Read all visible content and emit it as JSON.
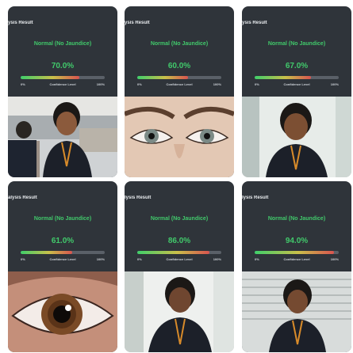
{
  "cards": [
    {
      "header": "ysis Result",
      "status": "Normal (No Jaundice)",
      "confidence_text": "70.0%",
      "confidence": 0.7,
      "scale": {
        "min": "0%",
        "label": "Confidence Level",
        "max": "100%"
      },
      "image": "classroom-portrait"
    },
    {
      "header": "ysis Result",
      "status": "Normal (No Jaundice)",
      "confidence_text": "60.0%",
      "confidence": 0.6,
      "scale": {
        "min": "0%",
        "label": "Confidence Level",
        "max": "100%"
      },
      "image": "two-eyes-closeup"
    },
    {
      "header": "ysis Result",
      "status": "Normal (No Jaundice)",
      "confidence_text": "67.0%",
      "confidence": 0.67,
      "scale": {
        "min": "0%",
        "label": "Confidence Level",
        "max": "100%"
      },
      "image": "portrait-window"
    },
    {
      "header": "alysis Result",
      "status": "Normal (No Jaundice)",
      "confidence_text": "61.0%",
      "confidence": 0.61,
      "scale": {
        "min": "0%",
        "label": "Confidence Level",
        "max": "100%"
      },
      "image": "eye-closeup"
    },
    {
      "header": "lysis Result",
      "status": "Normal (No Jaundice)",
      "confidence_text": "86.0%",
      "confidence": 0.86,
      "scale": {
        "min": "0%",
        "label": "Confidence Level",
        "max": "100%"
      },
      "image": "portrait-window"
    },
    {
      "header": "lysis Result",
      "status": "Normal (No Jaundice)",
      "confidence_text": "94.0%",
      "confidence": 0.94,
      "scale": {
        "min": "0%",
        "label": "Confidence Level",
        "max": "100%"
      },
      "image": "portrait-blinds"
    }
  ],
  "colors": {
    "card_bg": "#2f343a",
    "status_green": "#41c96b",
    "bar_track": "#5a6068",
    "bar_start": "#3fcf6a",
    "bar_end": "#d9534f"
  }
}
